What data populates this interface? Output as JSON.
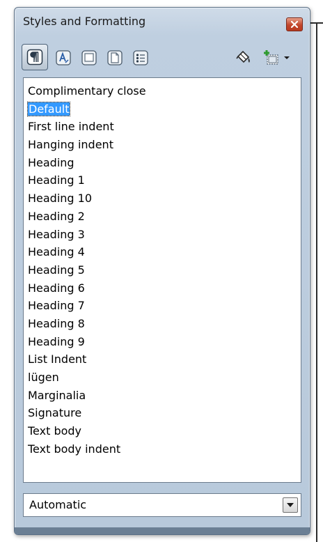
{
  "window": {
    "title": "Styles and Formatting",
    "accent": "#3399ff"
  },
  "toolbar": {
    "buttons": [
      {
        "icon": "paragraph-styles-icon",
        "active": true
      },
      {
        "icon": "character-styles-icon"
      },
      {
        "icon": "frame-styles-icon"
      },
      {
        "icon": "page-styles-icon"
      },
      {
        "icon": "list-styles-icon"
      },
      {
        "icon": "fill-format-mode-icon"
      },
      {
        "icon": "new-style-from-selection-icon"
      },
      {
        "icon": "dropdown-arrow-icon"
      }
    ]
  },
  "styles_list": {
    "items": [
      "Complimentary close",
      "Default",
      "First line indent",
      "Hanging indent",
      "Heading",
      "Heading 1",
      "Heading 10",
      "Heading 2",
      "Heading 3",
      "Heading 4",
      "Heading 5",
      "Heading 6",
      "Heading 7",
      "Heading 8",
      "Heading 9",
      "List Indent",
      "lügen",
      "Marginalia",
      "Signature",
      "Text body",
      "Text body indent"
    ],
    "selected": "Default"
  },
  "filter": {
    "value": "Automatic"
  }
}
